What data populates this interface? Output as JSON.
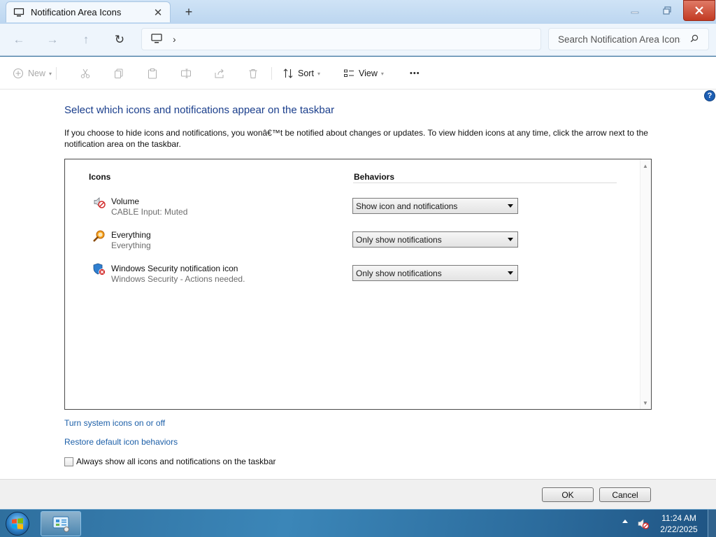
{
  "window": {
    "tab_title": "Notification Area Icons",
    "tab_close_glyph": "✕",
    "new_tab_glyph": "+"
  },
  "nav": {
    "back_glyph": "←",
    "forward_glyph": "→",
    "up_glyph": "↑",
    "refresh_glyph": "↻",
    "chevron_glyph": "›",
    "search_placeholder": "Search Notification Area Icons"
  },
  "commands": {
    "new_label": "New",
    "sort_label": "Sort",
    "view_label": "View",
    "more_glyph": "•••"
  },
  "content": {
    "heading": "Select which icons and notifications appear on the taskbar",
    "description": "If you choose to hide icons and notifications, you wonâ€™t be notified about changes or updates. To view hidden icons at any time, click the arrow next to the notification area on the taskbar.",
    "col_icons": "Icons",
    "col_behaviors": "Behaviors",
    "rows": [
      {
        "name": "Volume",
        "sub": "CABLE Input: Muted",
        "behavior": "Show icon and notifications",
        "icon": "muted-speaker-icon"
      },
      {
        "name": "Everything",
        "sub": "Everything",
        "behavior": "Only show notifications",
        "icon": "magnifier-icon"
      },
      {
        "name": "Windows Security notification icon",
        "sub": "Windows Security - Actions needed.",
        "behavior": "Only show notifications",
        "icon": "security-shield-icon"
      }
    ],
    "link_system_icons": "Turn system icons on or off",
    "link_restore": "Restore default icon behaviors",
    "always_show_label": "Always show all icons and notifications on the taskbar",
    "always_show_checked": false
  },
  "footer": {
    "ok_label": "OK",
    "cancel_label": "Cancel"
  },
  "taskbar": {
    "time": "11:24 AM",
    "date": "2/22/2025"
  },
  "colors": {
    "heading_blue": "#1a3e8c",
    "link_blue": "#1c5fa8",
    "close_red": "#c23a22"
  }
}
